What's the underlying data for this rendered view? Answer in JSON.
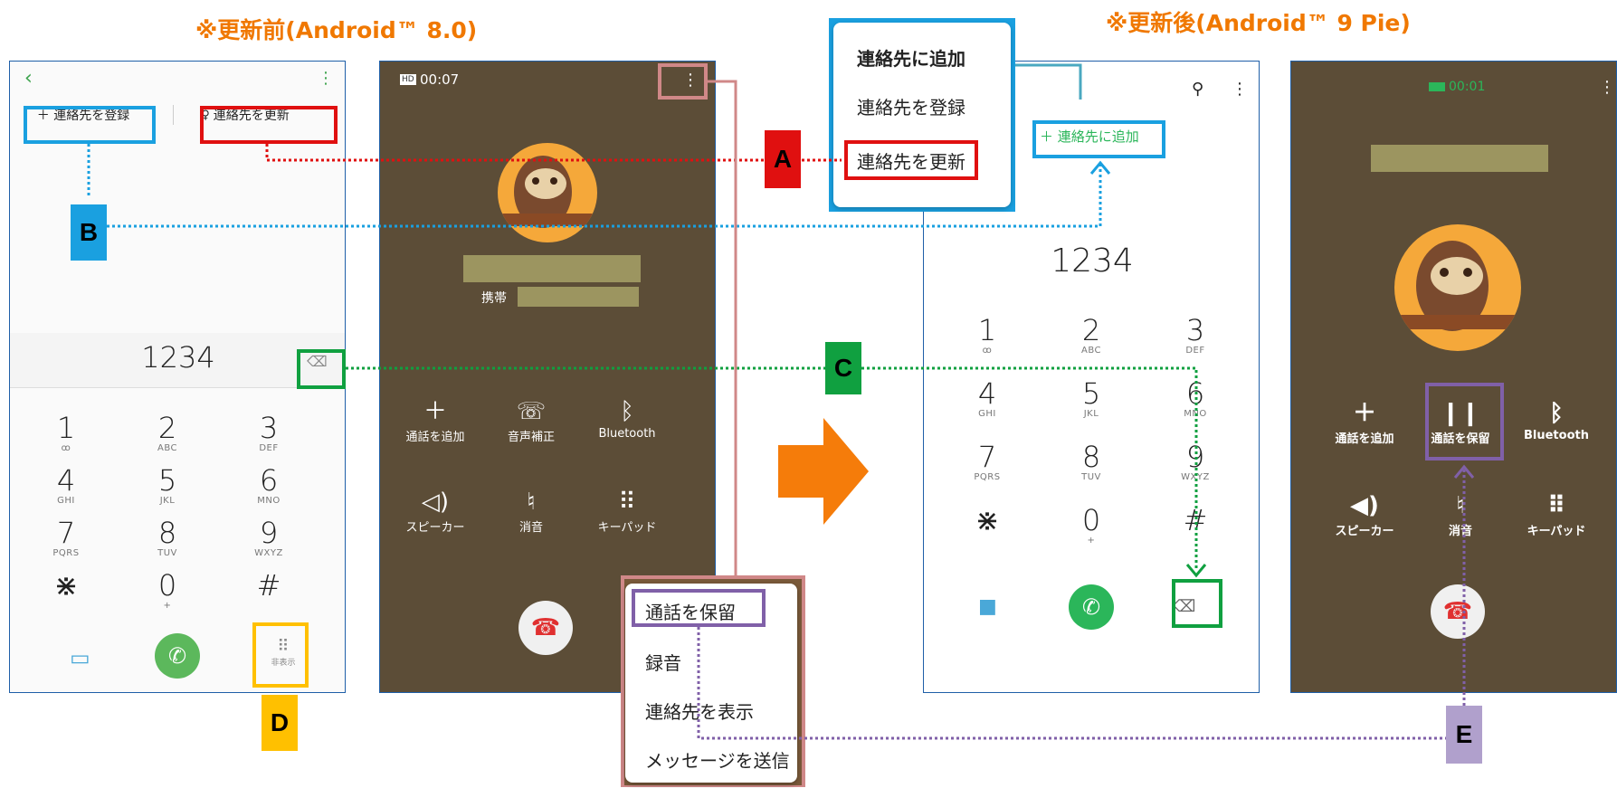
{
  "titles": {
    "before": "※更新前(Android™ 8.0)",
    "after": "※更新後(Android™ 9 Pie)"
  },
  "labels": {
    "a": "A",
    "b": "B",
    "c": "C",
    "d": "D",
    "e": "E"
  },
  "screen1": {
    "register_button": "＋ 連絡先を登録",
    "update_button": "連絡先を更新",
    "number": "1234",
    "keys": [
      {
        "digit": "1",
        "sub": "ꝏ"
      },
      {
        "digit": "2",
        "sub": "ABC"
      },
      {
        "digit": "3",
        "sub": "DEF"
      },
      {
        "digit": "4",
        "sub": "GHI"
      },
      {
        "digit": "5",
        "sub": "JKL"
      },
      {
        "digit": "6",
        "sub": "MNO"
      },
      {
        "digit": "7",
        "sub": "PQRS"
      },
      {
        "digit": "8",
        "sub": "TUV"
      },
      {
        "digit": "9",
        "sub": "WXYZ"
      },
      {
        "digit": "⋇",
        "sub": ""
      },
      {
        "digit": "0",
        "sub": "+"
      },
      {
        "digit": "#",
        "sub": ""
      }
    ],
    "hide_label": "非表示"
  },
  "screen2": {
    "call_timer": "00:07",
    "hd_badge": "HD",
    "mobile_label": "携帯",
    "controls": [
      {
        "icon": "plus-icon",
        "glyph": "＋",
        "label": "通話を追加"
      },
      {
        "icon": "voice-adjust-icon",
        "glyph": "☏",
        "label": "音声補正"
      },
      {
        "icon": "bluetooth-icon",
        "glyph": "ᛒ",
        "label": "Bluetooth"
      },
      {
        "icon": "speaker-icon",
        "glyph": "◁)",
        "label": "スピーカー"
      },
      {
        "icon": "mute-icon",
        "glyph": "♮",
        "label": "消音"
      },
      {
        "icon": "keypad-icon",
        "glyph": "⠿",
        "label": "キーパッド"
      }
    ],
    "menu": [
      "通話を保留",
      "録音",
      "連絡先を表示",
      "メッセージを送信"
    ]
  },
  "screen3": {
    "popup_title": "連絡先に追加",
    "popup_register": "連絡先を登録",
    "popup_update": "連絡先を更新",
    "add_contact": "＋ 連絡先に追加",
    "number": "1234",
    "keys": [
      {
        "digit": "1",
        "sub": "ꝏ"
      },
      {
        "digit": "2",
        "sub": "ABC"
      },
      {
        "digit": "3",
        "sub": "DEF"
      },
      {
        "digit": "4",
        "sub": "GHI"
      },
      {
        "digit": "5",
        "sub": "JKL"
      },
      {
        "digit": "6",
        "sub": "MNO"
      },
      {
        "digit": "7",
        "sub": "PQRS"
      },
      {
        "digit": "8",
        "sub": "TUV"
      },
      {
        "digit": "9",
        "sub": "WXYZ"
      },
      {
        "digit": "⋇",
        "sub": ""
      },
      {
        "digit": "0",
        "sub": "+"
      },
      {
        "digit": "#",
        "sub": ""
      }
    ]
  },
  "screen4": {
    "call_timer": "00:01",
    "controls": [
      {
        "icon": "plus-icon",
        "glyph": "＋",
        "label": "通話を追加"
      },
      {
        "icon": "pause-icon",
        "glyph": "❙❙",
        "label": "通話を保留"
      },
      {
        "icon": "bluetooth-icon",
        "glyph": "ᛒ",
        "label": "Bluetooth"
      },
      {
        "icon": "speaker-icon",
        "glyph": "◀)",
        "label": "スピーカー"
      },
      {
        "icon": "mute-icon",
        "glyph": "♮",
        "label": "消音"
      },
      {
        "icon": "keypad-icon",
        "glyph": "⠿",
        "label": "キーパッド"
      }
    ]
  },
  "colors": {
    "accent_orange": "#f07800",
    "blue": "#1aa0e0",
    "red": "#e01010",
    "green": "#10a040",
    "yellow": "#ffc000",
    "purple": "#8060a8",
    "call_green": "#2bb65a",
    "end_red": "#e03030"
  }
}
